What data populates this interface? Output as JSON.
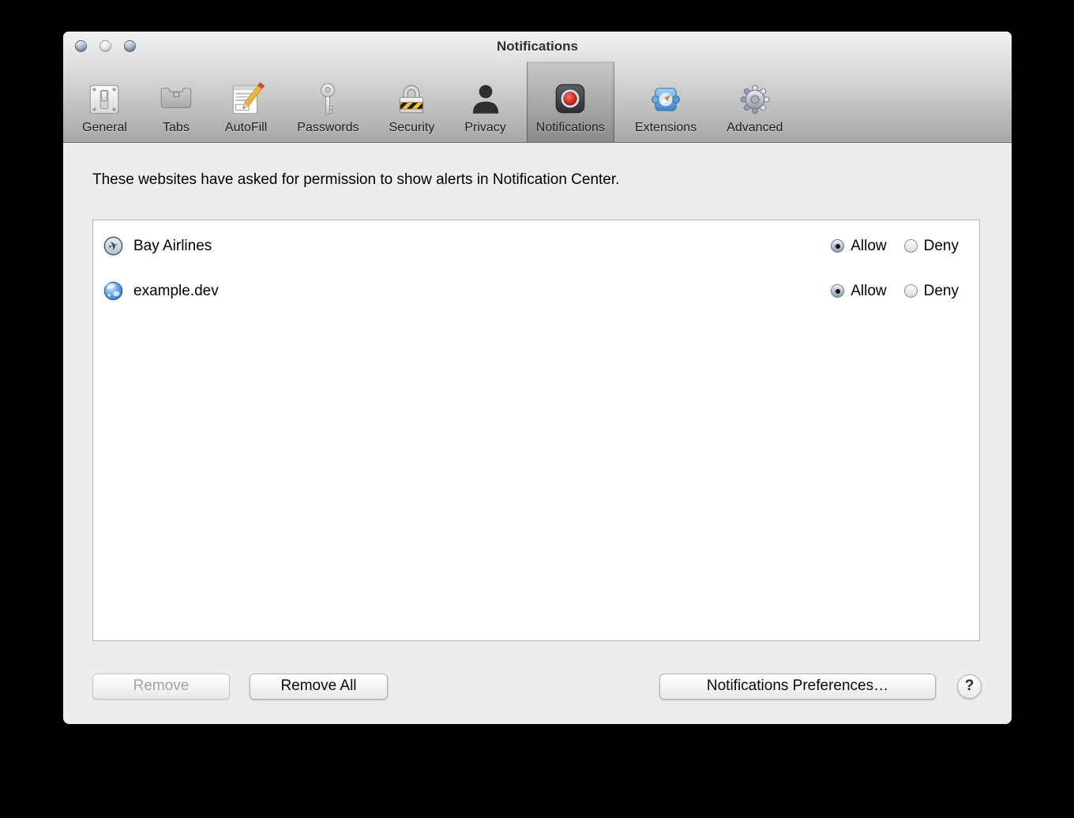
{
  "window": {
    "title": "Notifications"
  },
  "toolbar": {
    "items": [
      {
        "id": "general",
        "label": "General",
        "selected": false
      },
      {
        "id": "tabs",
        "label": "Tabs",
        "selected": false
      },
      {
        "id": "autofill",
        "label": "AutoFill",
        "selected": false
      },
      {
        "id": "passwords",
        "label": "Passwords",
        "selected": false
      },
      {
        "id": "security",
        "label": "Security",
        "selected": false
      },
      {
        "id": "privacy",
        "label": "Privacy",
        "selected": false
      },
      {
        "id": "notifications",
        "label": "Notifications",
        "selected": true
      },
      {
        "id": "extensions",
        "label": "Extensions",
        "selected": false
      },
      {
        "id": "advanced",
        "label": "Advanced",
        "selected": false
      }
    ]
  },
  "description": "These websites have asked for permission to show alerts in Notification Center.",
  "permission_options": {
    "allow": "Allow",
    "deny": "Deny"
  },
  "sites": [
    {
      "name": "Bay Airlines",
      "icon": "airplane-icon",
      "permission": "allow"
    },
    {
      "name": "example.dev",
      "icon": "globe-icon",
      "permission": "allow"
    }
  ],
  "footer": {
    "remove_label": "Remove",
    "remove_enabled": false,
    "remove_all_label": "Remove All",
    "preferences_label": "Notifications Preferences…",
    "help_label": "?"
  },
  "colors": {
    "record_red": "#cf1d12",
    "header_bottom_gray": "#a7a7a7",
    "content_background": "#ededed"
  }
}
